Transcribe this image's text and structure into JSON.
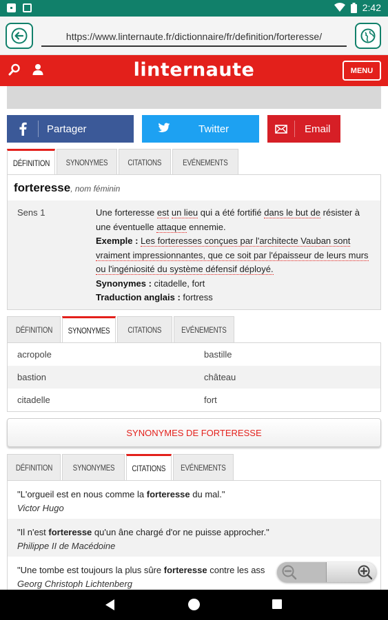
{
  "status_bar": {
    "time": "2:42"
  },
  "browser": {
    "url": "https://www.linternaute.fr/dictionnaire/fr/definition/forteresse/"
  },
  "header": {
    "logo": "linternaute",
    "menu_label": "MENU"
  },
  "share": {
    "facebook": "Partager",
    "twitter": "Twitter",
    "email": "Email"
  },
  "tabs": {
    "definition": "DÉFINITION",
    "synonymes": "SYNONYMES",
    "citations": "CITATIONS",
    "evenements": "EVÉNEMENTS"
  },
  "definition": {
    "word": "forteresse",
    "type": ", nom féminin",
    "sense_label": "Sens 1",
    "text_parts": [
      "Une forteresse ",
      "est",
      " ",
      "un lieu",
      " qui a été fortifié ",
      "dans le but de",
      " résister à une éventuelle ",
      "attaque",
      " ennemie."
    ],
    "example_label": "Exemple : ",
    "example_text": "Les forteresses conçues par l'architecte Vauban sont vraiment impressionnantes, que ce soit par l'épaisseur de leurs murs ou l'ingéniosité du système défensif déployé.",
    "synonyms_label": "Synonymes : ",
    "synonyms_text": "citadelle, fort",
    "translation_label": "Traduction anglais : ",
    "translation_text": "fortress"
  },
  "synonyms": [
    [
      "acropole",
      "bastille"
    ],
    [
      "bastion",
      "château"
    ],
    [
      "citadelle",
      "fort"
    ]
  ],
  "synonyms_button": "SYNONYMES DE FORTERESSE",
  "quotes": [
    {
      "before": "\"L'orgueil est en nous comme la ",
      "bold": "forteresse",
      "after": " du mal.\"",
      "author": "Victor Hugo"
    },
    {
      "before": "\"Il n'est ",
      "bold": "forteresse",
      "after": " qu'un âne chargé d'or ne puisse approcher.\"",
      "author": "Philippe II de Macédoine"
    },
    {
      "before": "\"Une tombe est toujours la plus sûre ",
      "bold": "forteresse",
      "after": " contre les ass",
      "author": "Georg Christoph Lichtenberg"
    }
  ],
  "colors": {
    "status": "#11806a",
    "brand_red": "#e3201b",
    "facebook": "#3b5998",
    "twitter": "#1da1f2",
    "email": "#d61f26"
  }
}
